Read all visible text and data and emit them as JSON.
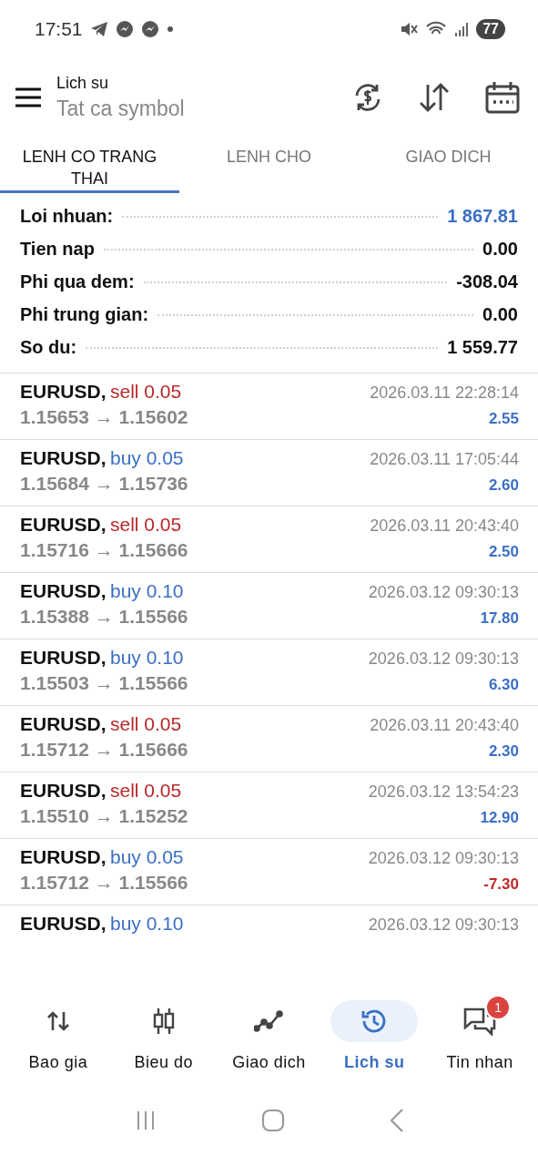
{
  "status_bar": {
    "time": "17:51",
    "battery": "77"
  },
  "header": {
    "title": "Lich su",
    "subtitle": "Tat ca symbol"
  },
  "tabs": [
    {
      "label": "LENH CO TRANG THAI",
      "selected": true
    },
    {
      "label": "LENH CHO",
      "selected": false
    },
    {
      "label": "GIAO DICH",
      "selected": false
    }
  ],
  "summary": [
    {
      "label": "Loi nhuan:",
      "value": "1 867.81",
      "highlight": true
    },
    {
      "label": "Tien nap",
      "value": "0.00",
      "highlight": false
    },
    {
      "label": "Phi qua dem:",
      "value": "-308.04",
      "highlight": false
    },
    {
      "label": "Phi trung gian:",
      "value": "0.00",
      "highlight": false
    },
    {
      "label": "So du:",
      "value": "1 559.77",
      "highlight": false
    }
  ],
  "trades": [
    {
      "symbol": "EURUSD,",
      "kind": "sell",
      "action": "sell 0.05",
      "prices": "1.15653 → 1.15602",
      "time": "2026.03.11 22:28:14",
      "profit": "2.55",
      "loss": false
    },
    {
      "symbol": "EURUSD,",
      "kind": "buy",
      "action": "buy 0.05",
      "prices": "1.15684 → 1.15736",
      "time": "2026.03.11 17:05:44",
      "profit": "2.60",
      "loss": false
    },
    {
      "symbol": "EURUSD,",
      "kind": "sell",
      "action": "sell 0.05",
      "prices": "1.15716 → 1.15666",
      "time": "2026.03.11 20:43:40",
      "profit": "2.50",
      "loss": false
    },
    {
      "symbol": "EURUSD,",
      "kind": "buy",
      "action": "buy 0.10",
      "prices": "1.15388 → 1.15566",
      "time": "2026.03.12 09:30:13",
      "profit": "17.80",
      "loss": false
    },
    {
      "symbol": "EURUSD,",
      "kind": "buy",
      "action": "buy 0.10",
      "prices": "1.15503 → 1.15566",
      "time": "2026.03.12 09:30:13",
      "profit": "6.30",
      "loss": false
    },
    {
      "symbol": "EURUSD,",
      "kind": "sell",
      "action": "sell 0.05",
      "prices": "1.15712 → 1.15666",
      "time": "2026.03.11 20:43:40",
      "profit": "2.30",
      "loss": false
    },
    {
      "symbol": "EURUSD,",
      "kind": "sell",
      "action": "sell 0.05",
      "prices": "1.15510 → 1.15252",
      "time": "2026.03.12 13:54:23",
      "profit": "12.90",
      "loss": false
    },
    {
      "symbol": "EURUSD,",
      "kind": "buy",
      "action": "buy 0.05",
      "prices": "1.15712 → 1.15566",
      "time": "2026.03.12 09:30:13",
      "profit": "-7.30",
      "loss": true
    },
    {
      "symbol": "EURUSD,",
      "kind": "buy",
      "action": "buy 0.10",
      "time": "2026.03.12 09:30:13"
    }
  ],
  "bottom_nav": [
    {
      "label": "Bao gia",
      "kind": "quotes",
      "selected": false
    },
    {
      "label": "Bieu do",
      "kind": "chart",
      "selected": false
    },
    {
      "label": "Giao dich",
      "kind": "trade",
      "selected": false
    },
    {
      "label": "Lich su",
      "kind": "history",
      "selected": true
    },
    {
      "label": "Tin nhan",
      "kind": "messages",
      "selected": false,
      "badge": "1"
    }
  ]
}
